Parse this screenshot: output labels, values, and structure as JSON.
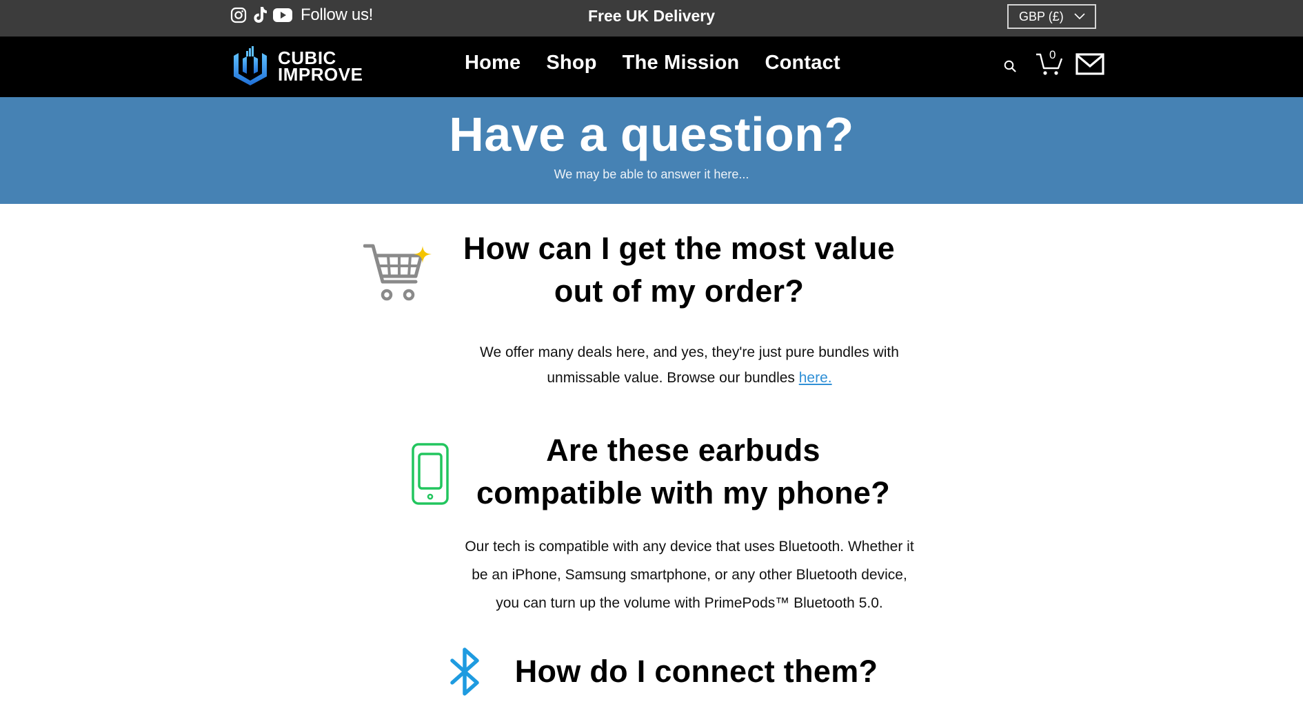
{
  "topbar": {
    "social_icons": [
      "instagram-icon",
      "tiktok-icon",
      "youtube-icon"
    ],
    "follow_label": "Follow us!",
    "announcement": "Free UK Delivery",
    "currency": "GBP (£)"
  },
  "nav": {
    "logo_line1": "CUBIC",
    "logo_line2": "IMPROVE",
    "items": [
      "Home",
      "Shop",
      "The Mission",
      "Contact"
    ],
    "cart_count": "0",
    "icons": [
      "search-icon",
      "cart-icon",
      "mail-icon"
    ]
  },
  "hero": {
    "title": "Have a question?",
    "subtitle": "We may be able to answer it here..."
  },
  "faq": [
    {
      "icon": "shopping-cart-sparkle-icon",
      "title_line1": "How can I get the most value",
      "title_line2": "out of my order?",
      "body_line1": "We offer many deals here, and yes, they're just pure bundles with",
      "body_line2": "unmissable value. Browse our bundles ",
      "link": "here."
    },
    {
      "icon": "smartphone-icon",
      "title_line1": "Are these earbuds",
      "title_line2": "compatible with my phone?",
      "body_line1": "Our tech is compatible with any device that uses Bluetooth. Whether it",
      "body_line2": "be an iPhone, Samsung smartphone, or any other Bluetooth device,",
      "body_line3": "you can turn up the volume with PrimePods™ Bluetooth 5.0."
    },
    {
      "icon": "bluetooth-icon",
      "title_line1": "How do I connect them?"
    }
  ],
  "colors": {
    "topbar": "#3c3c3c",
    "nav": "#000000",
    "hero": "#4682b4",
    "link": "#2f8fd6",
    "phone_icon": "#22c55e",
    "bluetooth_icon": "#1e9be0",
    "sparkle": "#f5c400"
  }
}
